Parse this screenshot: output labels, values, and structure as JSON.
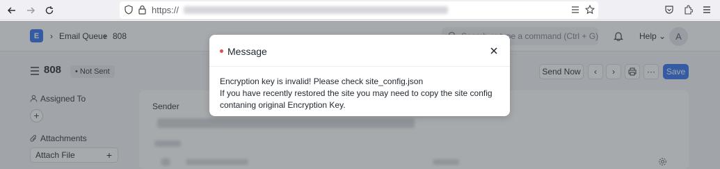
{
  "browser": {
    "url_prefix": "https://",
    "icons": [
      "back-icon",
      "forward-icon",
      "reload-icon",
      "shield-icon",
      "lock-icon",
      "reader-icon",
      "bookmark-star-icon",
      "pocket-icon",
      "extensions-icon",
      "menu-icon"
    ]
  },
  "app": {
    "logo_letter": "E",
    "breadcrumb": [
      "Email Queue",
      "808"
    ],
    "search_placeholder": "Search or type a command (Ctrl + G)",
    "help_label": "Help",
    "avatar_letter": "A"
  },
  "doc": {
    "title": "808",
    "status": "Not Sent",
    "actions": {
      "send_now": "Send Now",
      "save": "Save",
      "more": "···"
    },
    "sidebar": {
      "assigned_to": "Assigned To",
      "attachments": "Attachments",
      "attach_file": "Attach File"
    },
    "form": {
      "sender_label": "Sender"
    }
  },
  "dialog": {
    "title": "Message",
    "indicator_color": "#e24c4c",
    "lines": [
      "Encryption key is invalid! Please check site_config.json",
      "If you have recently restored the site you may need to copy the site config",
      "contaning original Encryption Key."
    ]
  }
}
